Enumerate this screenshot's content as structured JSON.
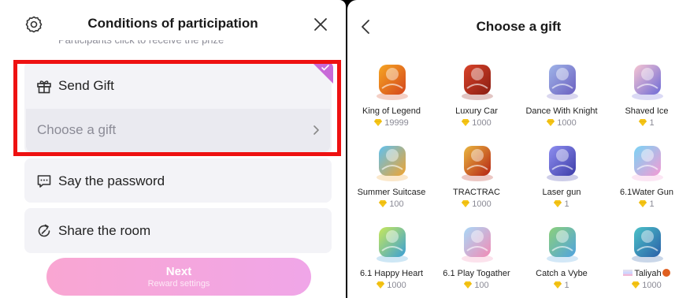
{
  "left_panel": {
    "title": "Conditions of participation",
    "cut_text": "Participants click to receive the prize",
    "send_gift": {
      "label": "Send Gift",
      "choose_label": "Choose a gift",
      "selected": true
    },
    "password": {
      "label": "Say the password"
    },
    "share": {
      "label": "Share the room"
    },
    "next_button": {
      "label": "Next",
      "sublabel": "Reward settings"
    },
    "colors": {
      "highlight_border": "#ee1111",
      "check_corner": "#c86ad8",
      "next_gradient_start": "#f9a6d2",
      "next_gradient_end": "#f0a6e8"
    }
  },
  "right_panel": {
    "title": "Choose a gift",
    "gifts": [
      {
        "name": "King of Legend",
        "price": "19999",
        "icon": "golden-throne-icon",
        "colors": [
          "#f6a623",
          "#d4451c"
        ]
      },
      {
        "name": "Luxury Car",
        "price": "1000",
        "icon": "sports-car-icon",
        "colors": [
          "#d8432a",
          "#8a1d12"
        ]
      },
      {
        "name": "Dance With Knight",
        "price": "1000",
        "icon": "gazebo-icon",
        "colors": [
          "#9fb4e8",
          "#6b5fc0"
        ]
      },
      {
        "name": "Shaved Ice",
        "price": "1",
        "icon": "shaved-ice-icon",
        "colors": [
          "#f7c5d2",
          "#6e6bd6"
        ]
      },
      {
        "name": "Summer Suitcase",
        "price": "100",
        "icon": "suitcase-icon",
        "colors": [
          "#5fc1f0",
          "#f0a430"
        ]
      },
      {
        "name": "TRACTRAC",
        "price": "1000",
        "icon": "crest-icon",
        "colors": [
          "#e9b640",
          "#b52414"
        ]
      },
      {
        "name": "Laser gun",
        "price": "1",
        "icon": "laser-gun-icon",
        "colors": [
          "#8e8ef0",
          "#3d3da8"
        ]
      },
      {
        "name": "6.1Water Gun",
        "price": "1",
        "icon": "water-gun-icon",
        "colors": [
          "#7ad4f5",
          "#f49ad4"
        ]
      },
      {
        "name": "6.1 Happy Heart",
        "price": "1000",
        "icon": "toy-car-icon",
        "colors": [
          "#c8e85a",
          "#3a9fd6"
        ]
      },
      {
        "name": "6.1 Play Togather",
        "price": "100",
        "icon": "play-together-icon",
        "colors": [
          "#a8d8f7",
          "#f28bb5"
        ]
      },
      {
        "name": "Catch a Vybe",
        "price": "1",
        "icon": "island-plane-icon",
        "colors": [
          "#8dd07a",
          "#4fa3e0"
        ]
      },
      {
        "name": "Taliyah",
        "price": "1000",
        "icon": "taliyah-icon",
        "colors": [
          "#4cc2c8",
          "#2a5fa8"
        ],
        "flag": true,
        "badge": true
      }
    ]
  }
}
